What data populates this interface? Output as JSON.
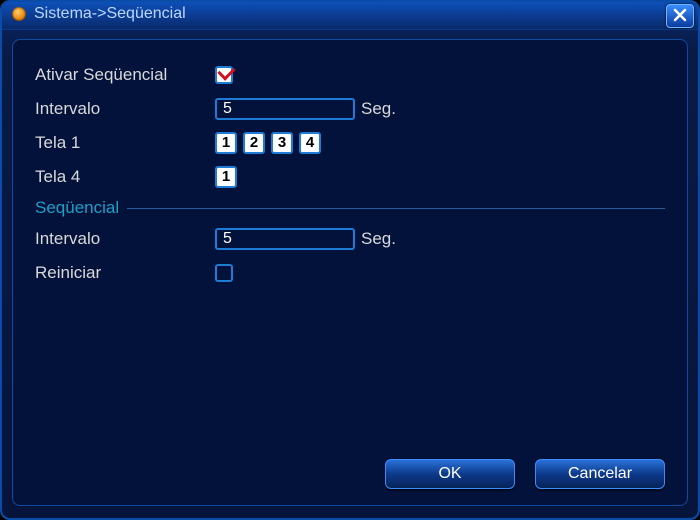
{
  "title": "Sistema->Seqüencial",
  "labels": {
    "ativar": "Ativar Seqüencial",
    "intervalo1": "Intervalo",
    "seg": "Seg.",
    "tela1": "Tela 1",
    "tela4": "Tela 4",
    "section": "Seqüencial",
    "intervalo2": "Intervalo",
    "reiniciar": "Reiniciar"
  },
  "values": {
    "ativar_checked": true,
    "intervalo1": "5",
    "intervalo2": "5",
    "reiniciar_checked": false
  },
  "tela1_buttons": [
    "1",
    "2",
    "3",
    "4"
  ],
  "tela4_buttons": [
    "1"
  ],
  "buttons": {
    "ok": "OK",
    "cancel": "Cancelar"
  }
}
